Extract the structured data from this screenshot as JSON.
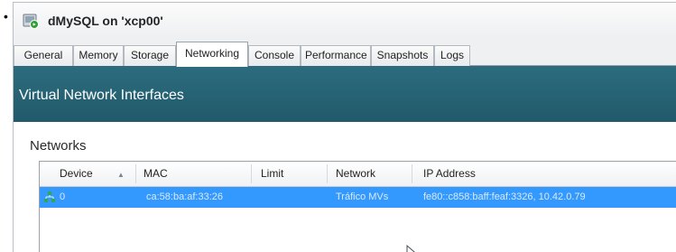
{
  "window": {
    "title": "dMySQL on 'xcp00'",
    "icon": "vm-running-icon"
  },
  "tabs": [
    {
      "label": "General",
      "active": false
    },
    {
      "label": "Memory",
      "active": false
    },
    {
      "label": "Storage",
      "active": false
    },
    {
      "label": "Networking",
      "active": true
    },
    {
      "label": "Console",
      "active": false
    },
    {
      "label": "Performance",
      "active": false
    },
    {
      "label": "Snapshots",
      "active": false
    },
    {
      "label": "Logs",
      "active": false
    }
  ],
  "banner": {
    "title": "Virtual Network Interfaces"
  },
  "networks": {
    "label": "Networks",
    "columns": [
      "Device",
      "MAC",
      "Limit",
      "Network",
      "IP Address"
    ],
    "rows": [
      {
        "device": "0",
        "mac": "ca:58:ba:af:33:26",
        "limit": "",
        "network": "Tráfico MVs",
        "ip": "fe80::c858:baff:feaf:3326, 10.42.0.79"
      }
    ]
  },
  "colors": {
    "banner": "#25606f",
    "selection": "#3399ff"
  }
}
